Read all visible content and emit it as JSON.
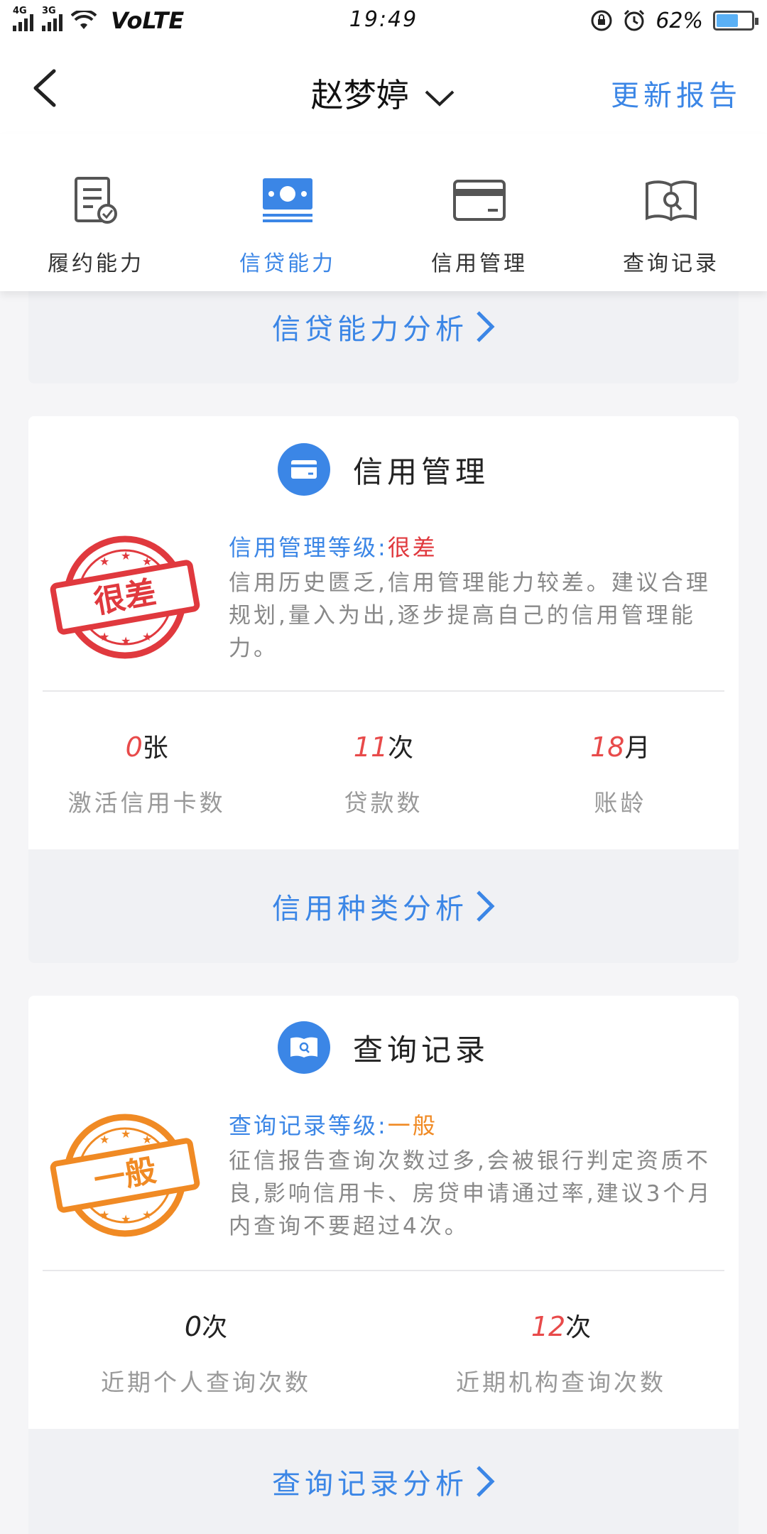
{
  "status_bar": {
    "net1": "4G",
    "net2": "3G",
    "volte": "VoLTE",
    "time": "19:49",
    "battery": "62%"
  },
  "header": {
    "title": "赵梦婷",
    "action": "更新报告"
  },
  "tabs": [
    {
      "label": "履约能力",
      "icon": "contract-check-icon"
    },
    {
      "label": "信贷能力",
      "icon": "money-icon",
      "active": true
    },
    {
      "label": "信用管理",
      "icon": "credit-card-icon"
    },
    {
      "label": "查询记录",
      "icon": "book-search-icon"
    }
  ],
  "credit_ability": {
    "link": "信贷能力分析"
  },
  "credit_management": {
    "title": "信用管理",
    "level_label": "信用管理等级:",
    "level_value": "很差",
    "description": "信用历史匮乏,信用管理能力较差。建议合理规划,量入为出,逐步提高自己的信用管理能力。",
    "stats": [
      {
        "value": "0",
        "unit": "张",
        "caption": "激活信用卡数"
      },
      {
        "value": "11",
        "unit": "次",
        "caption": "贷款数"
      },
      {
        "value": "18",
        "unit": "月",
        "caption": "账龄"
      }
    ],
    "link": "信用种类分析",
    "stamp": "很差"
  },
  "query_record": {
    "title": "查询记录",
    "level_label": "查询记录等级:",
    "level_value": "一般",
    "description": "征信报告查询次数过多,会被银行判定资质不良,影响信用卡、房贷申请通过率,建议3个月内查询不要超过4次。",
    "stats": [
      {
        "value": "0",
        "unit": "次",
        "caption": "近期个人查询次数"
      },
      {
        "value": "12",
        "unit": "次",
        "caption": "近期机构查询次数"
      }
    ],
    "link": "查询记录分析",
    "stamp": "一般"
  },
  "colors": {
    "accent": "#3b86e6",
    "bad": "#e0393e",
    "medium": "#f08a24"
  }
}
